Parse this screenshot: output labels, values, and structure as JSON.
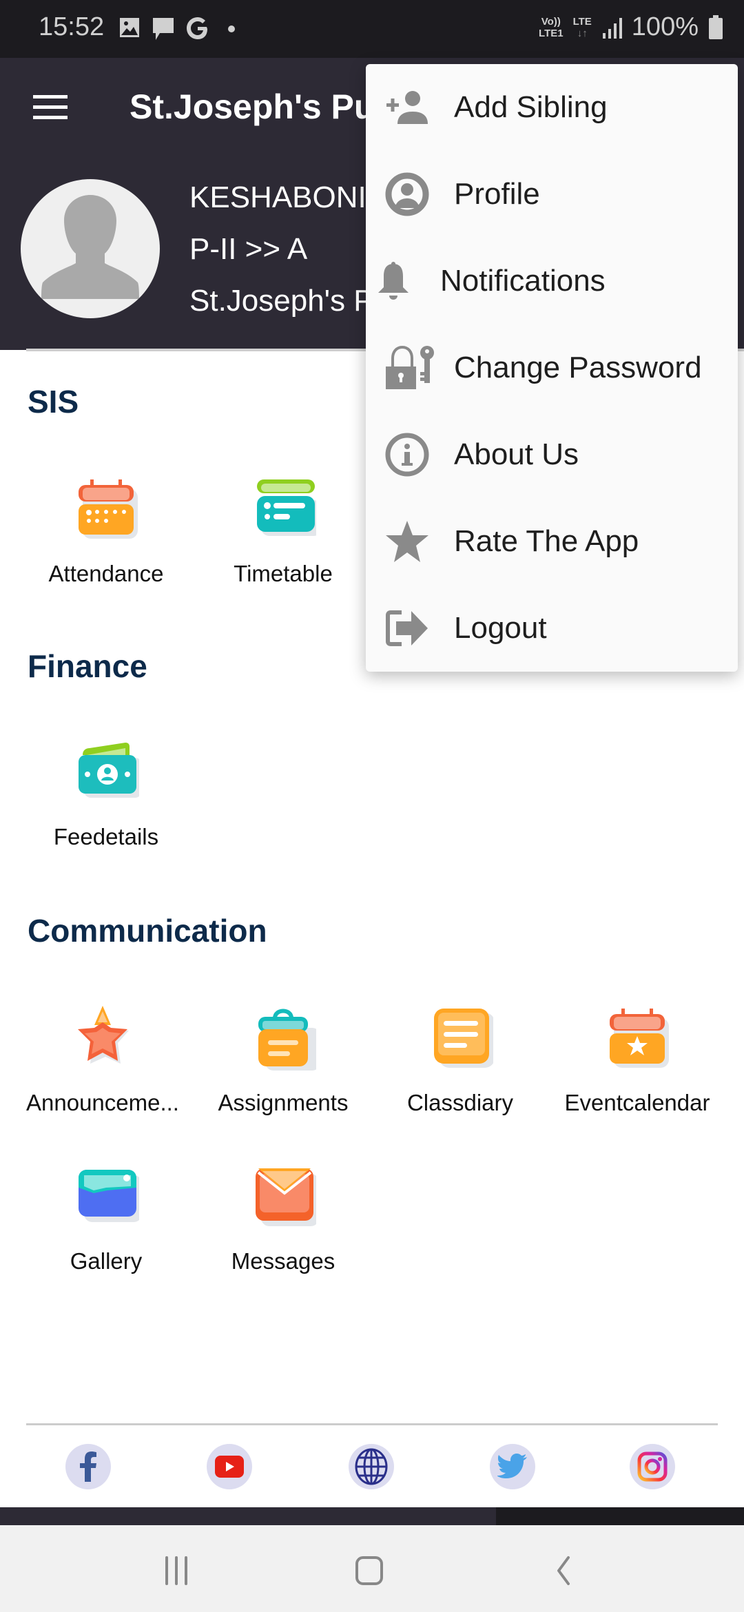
{
  "status_bar": {
    "time": "15:52",
    "notification_icons": [
      "gallery-icon",
      "message-icon",
      "google-icon",
      "dot-icon"
    ],
    "network_top": "Vo))",
    "network_bottom": "LTE1",
    "lte_label": "LTE",
    "battery": "100%"
  },
  "app_bar": {
    "title": "St.Joseph's Public School",
    "menu_icon": "hamburger-icon"
  },
  "student": {
    "name": "KESHABONI",
    "class": "P-II >> A",
    "school": "St.Joseph's Public School"
  },
  "sections": [
    {
      "title": "SIS",
      "items": [
        {
          "label": "Attendance",
          "icon": "attendance-calendar-icon"
        },
        {
          "label": "Timetable",
          "icon": "timetable-icon"
        }
      ]
    },
    {
      "title": "Finance",
      "items": [
        {
          "label": "Feedetails",
          "icon": "fee-money-icon"
        }
      ]
    },
    {
      "title": "Communication",
      "items": [
        {
          "label": "Announceme...",
          "icon": "announcement-star-icon"
        },
        {
          "label": "Assignments",
          "icon": "assignment-clipboard-icon"
        },
        {
          "label": "Classdiary",
          "icon": "classdiary-notes-icon"
        },
        {
          "label": "Eventcalendar",
          "icon": "event-calendar-icon"
        },
        {
          "label": "Gallery",
          "icon": "gallery-photo-icon"
        },
        {
          "label": "Messages",
          "icon": "messages-envelope-icon"
        }
      ]
    }
  ],
  "social_links": [
    {
      "name": "facebook",
      "icon": "facebook-icon",
      "color": "#3b5998"
    },
    {
      "name": "youtube",
      "icon": "youtube-icon",
      "color": "#e62117"
    },
    {
      "name": "website",
      "icon": "globe-icon",
      "color": "#2a2f8a"
    },
    {
      "name": "twitter",
      "icon": "twitter-icon",
      "color": "#4aa3e8"
    },
    {
      "name": "instagram",
      "icon": "instagram-icon",
      "color": "#d6249f"
    }
  ],
  "overflow_menu": {
    "items": [
      {
        "label": "Add Sibling",
        "icon": "add-person-icon"
      },
      {
        "label": "Profile",
        "icon": "profile-circle-icon"
      },
      {
        "label": "Notifications",
        "icon": "bell-icon"
      },
      {
        "label": "Change Password",
        "icon": "lock-key-icon"
      },
      {
        "label": "About Us",
        "icon": "info-icon"
      },
      {
        "label": "Rate The App",
        "icon": "star-icon"
      },
      {
        "label": "Logout",
        "icon": "logout-icon"
      }
    ]
  },
  "nav_bar": {
    "recents": "recents-icon",
    "home": "home-icon",
    "back": "back-icon"
  },
  "colors": {
    "header_bg": "#2d2a35",
    "section_title": "#0d2a4a",
    "menu_icon_gray": "#8a8a8a"
  }
}
